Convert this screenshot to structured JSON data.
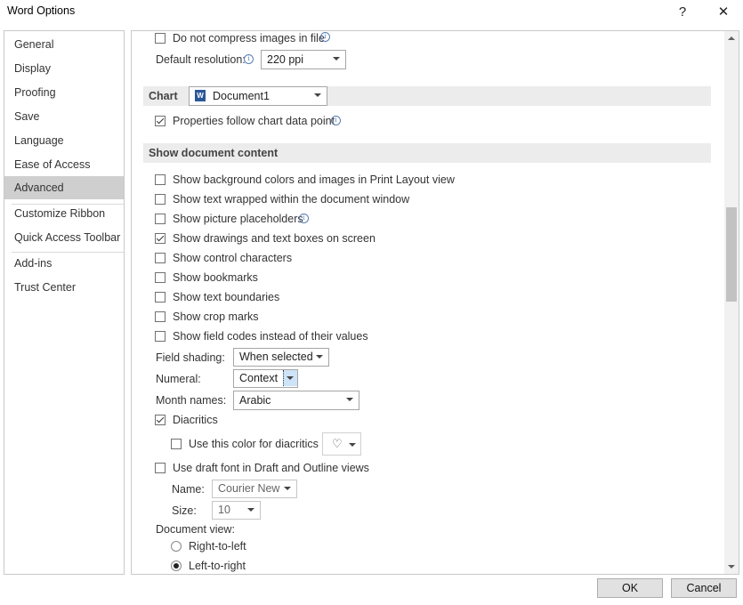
{
  "window": {
    "title": "Word Options",
    "help": "?",
    "close": "✕"
  },
  "sidebar": {
    "items": [
      {
        "label": "General"
      },
      {
        "label": "Display"
      },
      {
        "label": "Proofing"
      },
      {
        "label": "Save"
      },
      {
        "label": "Language"
      },
      {
        "label": "Ease of Access"
      },
      {
        "label": "Advanced",
        "selected": true
      },
      {
        "label": "Customize Ribbon"
      },
      {
        "label": "Quick Access Toolbar"
      },
      {
        "label": "Add-ins"
      },
      {
        "label": "Trust Center"
      }
    ]
  },
  "image": {
    "no_compress_label": "Do not compress images in file",
    "no_compress_checked": false,
    "resolution_label": "Default resolution:",
    "resolution_value": "220 ppi"
  },
  "chart": {
    "header": "Chart",
    "document": "Document1",
    "properties_follow_label": "Properties follow chart data point",
    "properties_follow_checked": true
  },
  "show_document_content": {
    "header": "Show document content",
    "options": [
      {
        "label": "Show background colors and images in Print Layout view",
        "checked": false
      },
      {
        "label": "Show text wrapped within the document window",
        "checked": false
      },
      {
        "label": "Show picture placeholders",
        "checked": false,
        "info": true
      },
      {
        "label": "Show drawings and text boxes on screen",
        "checked": true
      },
      {
        "label": "Show control characters",
        "checked": false
      },
      {
        "label": "Show bookmarks",
        "checked": false
      },
      {
        "label": "Show text boundaries",
        "checked": false
      },
      {
        "label": "Show crop marks",
        "checked": false
      },
      {
        "label": "Show field codes instead of their values",
        "checked": false
      }
    ],
    "field_shading_label": "Field shading:",
    "field_shading_value": "When selected",
    "numeral_label": "Numeral:",
    "numeral_value": "Context",
    "month_names_label": "Month names:",
    "month_names_value": "Arabic",
    "diacritics_label": "Diacritics",
    "diacritics_checked": true,
    "diacritics_color_label": "Use this color for diacritics",
    "diacritics_color_checked": false,
    "draft_font_label": "Use draft font in Draft and Outline views",
    "draft_font_checked": false,
    "name_label": "Name:",
    "name_value": "Courier New",
    "size_label": "Size:",
    "size_value": "10",
    "document_view_label": "Document view:",
    "rtl_label": "Right-to-left",
    "ltr_label": "Left-to-right",
    "document_view_selected": "Left-to-right"
  },
  "footer": {
    "ok_label": "OK",
    "cancel_label": "Cancel"
  },
  "icons": {
    "info": "info-icon",
    "word_document": "word-document-icon",
    "paint_bucket": "paint-bucket-icon"
  }
}
